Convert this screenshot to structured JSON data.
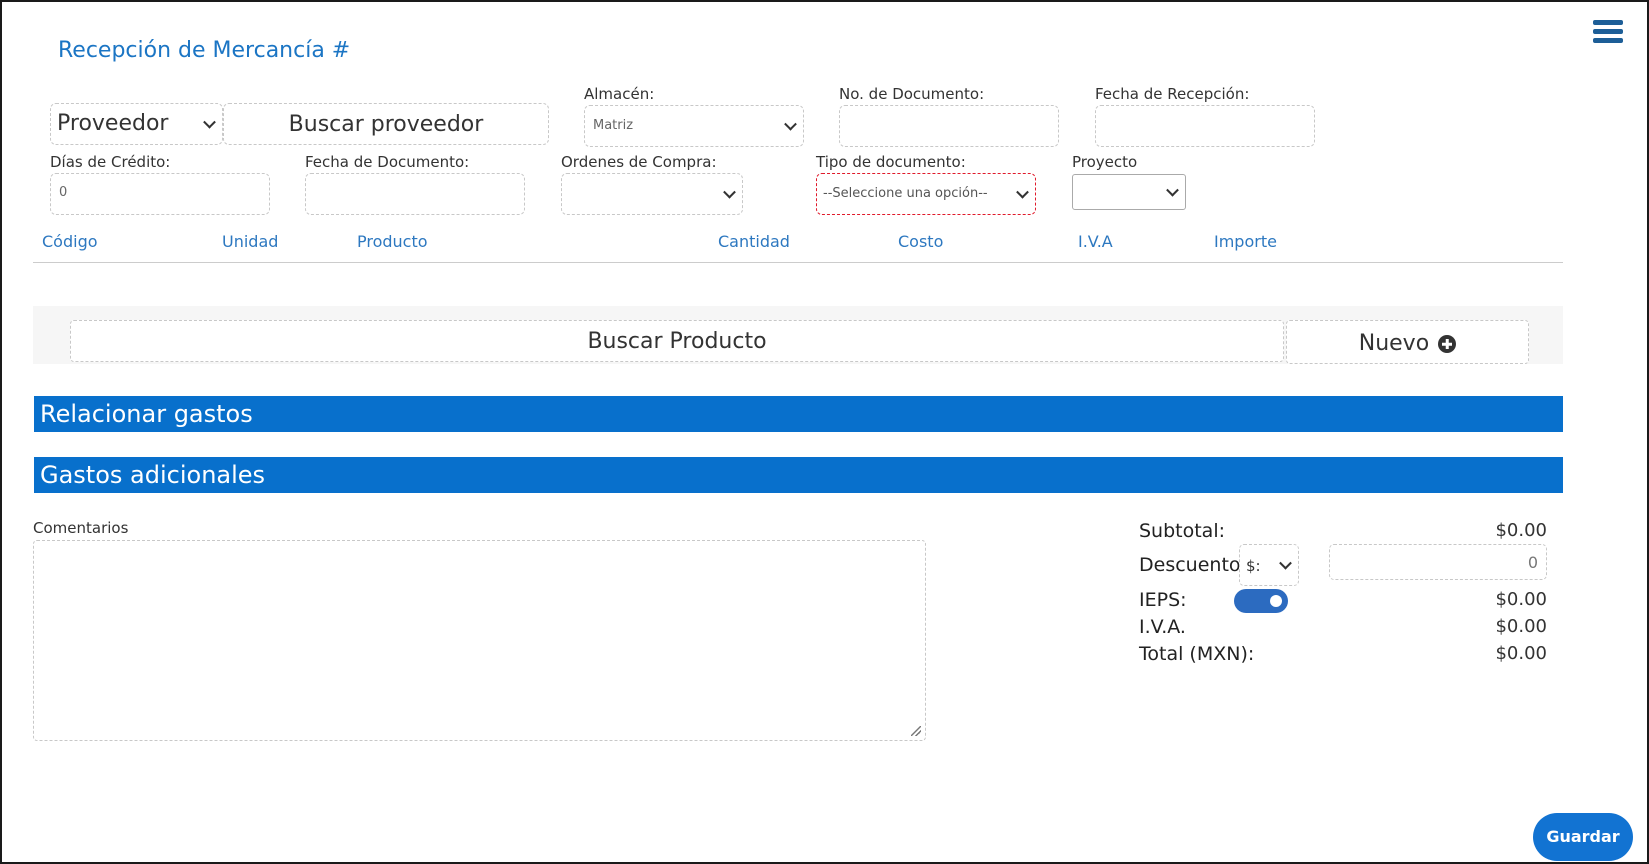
{
  "page": {
    "title": "Recepción de Mercancía #"
  },
  "icons": {
    "menu": "hamburger-menu-icon",
    "chevron": "chevron-down-icon",
    "add": "plus-circle-icon",
    "resize": "resize-grip-icon"
  },
  "colors": {
    "accent": "#1b75c4",
    "bar": "#0870cc",
    "button": "#1273d2",
    "toggle": "#2c6bc0",
    "error_border": "#e01a2b"
  },
  "supplier": {
    "type_value": "Proveedor",
    "search_placeholder": "Buscar proveedor"
  },
  "fields": {
    "almacen_label": "Almacén:",
    "almacen_value": "Matriz",
    "no_documento_label": "No. de Documento:",
    "no_documento_value": "",
    "fecha_recepcion_label": "Fecha de Recepción:",
    "fecha_recepcion_value": "",
    "dias_credito_label": "Días de Crédito:",
    "dias_credito_value": "0",
    "fecha_documento_label": "Fecha de Documento:",
    "fecha_documento_value": "",
    "ordenes_compra_label": "Ordenes de Compra:",
    "ordenes_compra_value": "",
    "tipo_documento_label": "Tipo de documento:",
    "tipo_documento_value": "--Seleccione una opción--",
    "proyecto_label": "Proyecto",
    "proyecto_value": ""
  },
  "table": {
    "columns": [
      "Código",
      "Unidad",
      "Producto",
      "Cantidad",
      "Costo",
      "I.V.A",
      "Importe"
    ]
  },
  "product": {
    "search_placeholder": "Buscar Producto",
    "new_label": "Nuevo"
  },
  "sections": {
    "relacionar_gastos": "Relacionar gastos",
    "gastos_adicionales": "Gastos adicionales"
  },
  "comments": {
    "label": "Comentarios",
    "value": ""
  },
  "totals": {
    "subtotal_label": "Subtotal:",
    "subtotal_value": "$0.00",
    "descuento_label": "Descuento",
    "descuento_type": "$:",
    "descuento_value": "0",
    "ieps_label": "IEPS:",
    "ieps_enabled": true,
    "ieps_value": "$0.00",
    "iva_label": "I.V.A.",
    "iva_value": "$0.00",
    "total_label": "Total (MXN):",
    "total_value": "$0.00"
  },
  "actions": {
    "save_label": "Guardar"
  }
}
